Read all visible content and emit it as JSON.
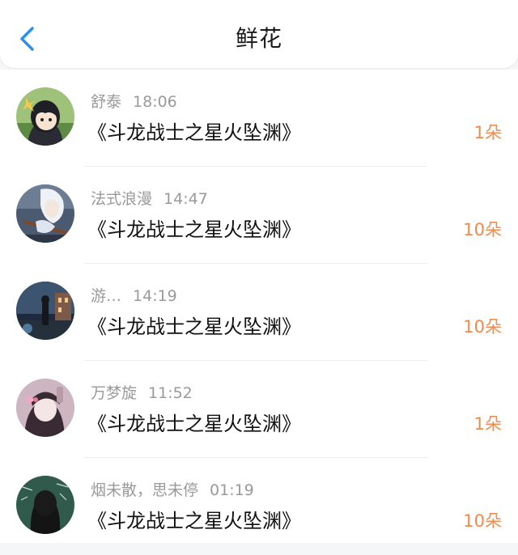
{
  "header": {
    "title": "鲜花",
    "back_icon": "chevron-left-icon",
    "accent_color": "#2f8fe8"
  },
  "list": {
    "count_color": "#f08a4b",
    "items": [
      {
        "name": "舒泰",
        "time": "18:06",
        "book": "《斗龙战士之星火坠渊》",
        "count": "1朵",
        "avatar": "avatar-anime-girl-black-hair"
      },
      {
        "name": "法式浪漫",
        "time": "14:47",
        "book": "《斗龙战士之星火坠渊》",
        "count": "10朵",
        "avatar": "avatar-anime-white-hair-violin"
      },
      {
        "name": "游…",
        "time": "14:19",
        "book": "《斗龙战士之星火坠渊》",
        "count": "10朵",
        "avatar": "avatar-night-street-figure"
      },
      {
        "name": "万梦旋",
        "time": "11:52",
        "book": "《斗龙战士之星火坠渊》",
        "count": "1朵",
        "avatar": "avatar-anime-girl-pink-bow"
      },
      {
        "name": "烟未散，思未停",
        "time": "01:19",
        "book": "《斗龙战士之星火坠渊》",
        "count": "10朵",
        "avatar": "avatar-girl-chalkboard"
      }
    ]
  }
}
